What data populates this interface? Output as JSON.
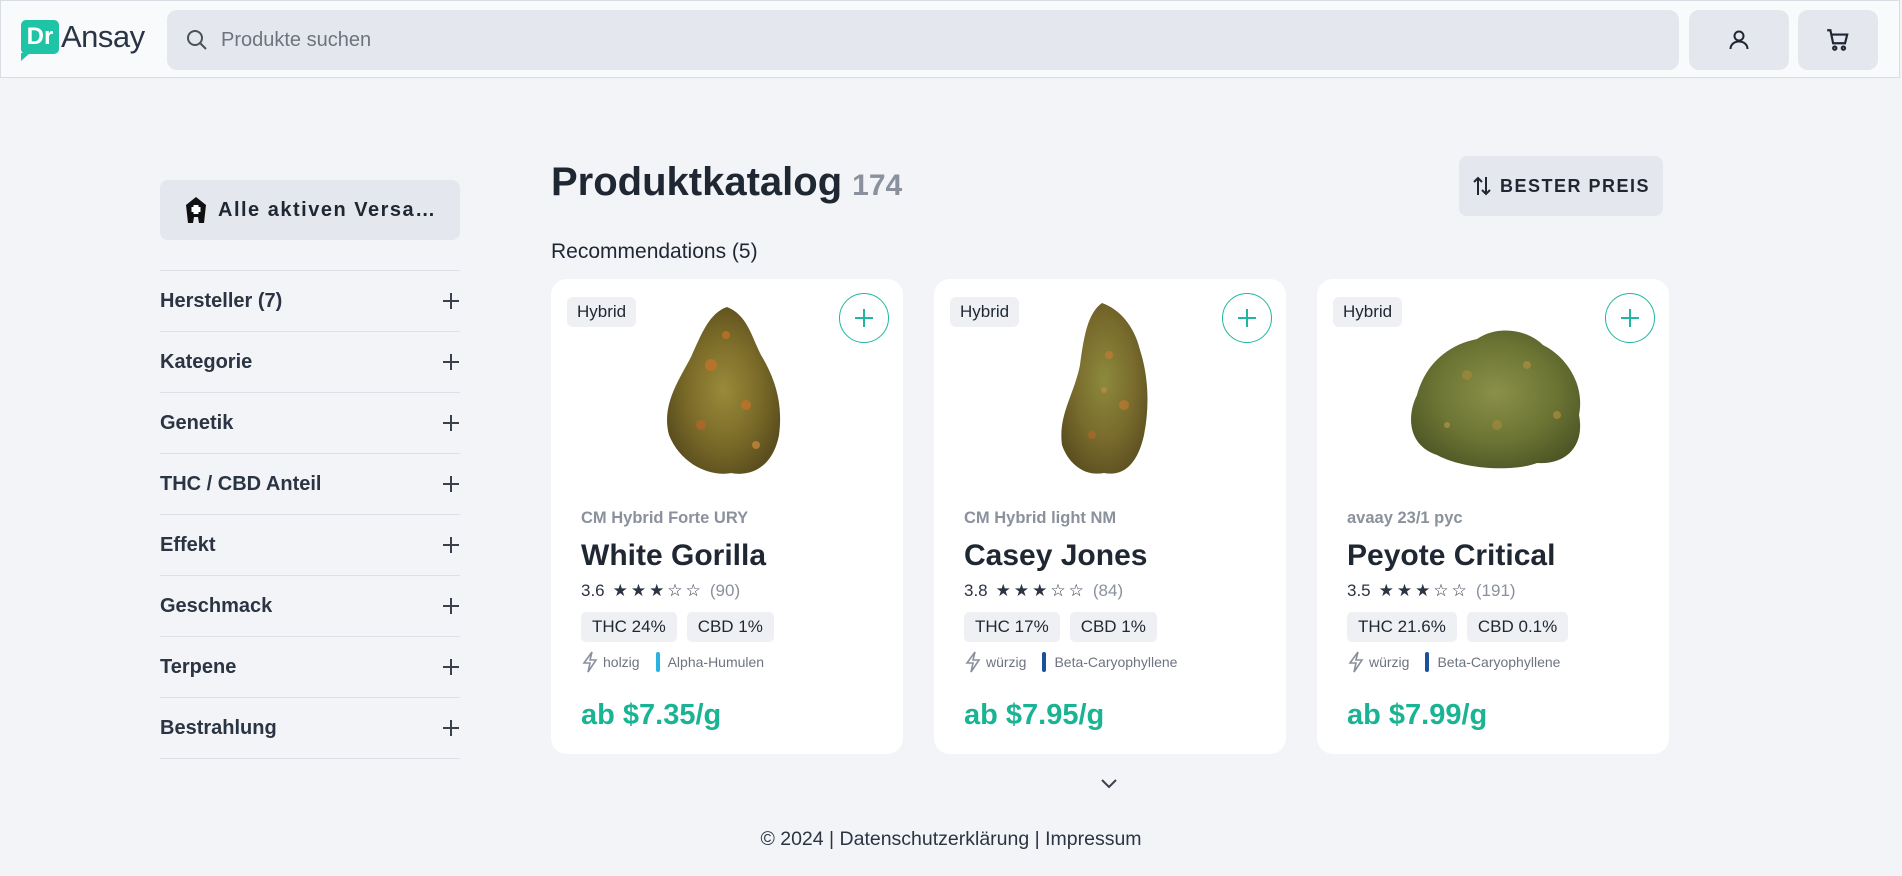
{
  "header": {
    "logo_badge": "Dr",
    "logo_text": "Ansay",
    "search_placeholder": "Produkte suchen",
    "icons": [
      "search-icon",
      "user-icon",
      "cart-icon"
    ]
  },
  "sidebar": {
    "shipping_button": "Alle aktiven Versandapotheken",
    "filters": [
      {
        "label": "Hersteller (7)"
      },
      {
        "label": "Kategorie"
      },
      {
        "label": "Genetik"
      },
      {
        "label": "THC / CBD Anteil"
      },
      {
        "label": "Effekt"
      },
      {
        "label": "Geschmack"
      },
      {
        "label": "Terpene"
      },
      {
        "label": "Bestrahlung"
      }
    ]
  },
  "main": {
    "title": "Produktkatalog",
    "count": "174",
    "sort_label": "BESTER PREIS",
    "recommendations_label": "Recommendations (5)"
  },
  "products": [
    {
      "badge": "Hybrid",
      "manufacturer": "CM Hybrid Forte URY",
      "name": "White Gorilla",
      "rating": "3.6",
      "stars_filled": 3,
      "reviews": "(90)",
      "thc": "THC 24%",
      "cbd": "CBD 1%",
      "effect": "holzig",
      "terpene": "Alpha-Humulen",
      "terpene_color": "#2bb3e0",
      "price": "ab $7.35/g"
    },
    {
      "badge": "Hybrid",
      "manufacturer": "CM Hybrid light NM",
      "name": "Casey Jones",
      "rating": "3.8",
      "stars_filled": 3,
      "reviews": "(84)",
      "thc": "THC 17%",
      "cbd": "CBD 1%",
      "effect": "würzig",
      "terpene": "Beta-Caryophyllene",
      "terpene_color": "#1c4f9c",
      "price": "ab $7.95/g"
    },
    {
      "badge": "Hybrid",
      "manufacturer": "avaay 23/1 pyc",
      "name": "Peyote Critical",
      "rating": "3.5",
      "stars_filled": 3,
      "reviews": "(191)",
      "thc": "THC 21.6%",
      "cbd": "CBD 0.1%",
      "effect": "würzig",
      "terpene": "Beta-Caryophyllene",
      "terpene_color": "#1c4f9c",
      "price": "ab $7.99/g"
    }
  ],
  "footer": {
    "text": "© 2024 | Datenschutzerklärung | Impressum"
  },
  "colors": {
    "accent": "#1fc3a6",
    "price": "#1ab394",
    "background": "#f2f4f8"
  }
}
